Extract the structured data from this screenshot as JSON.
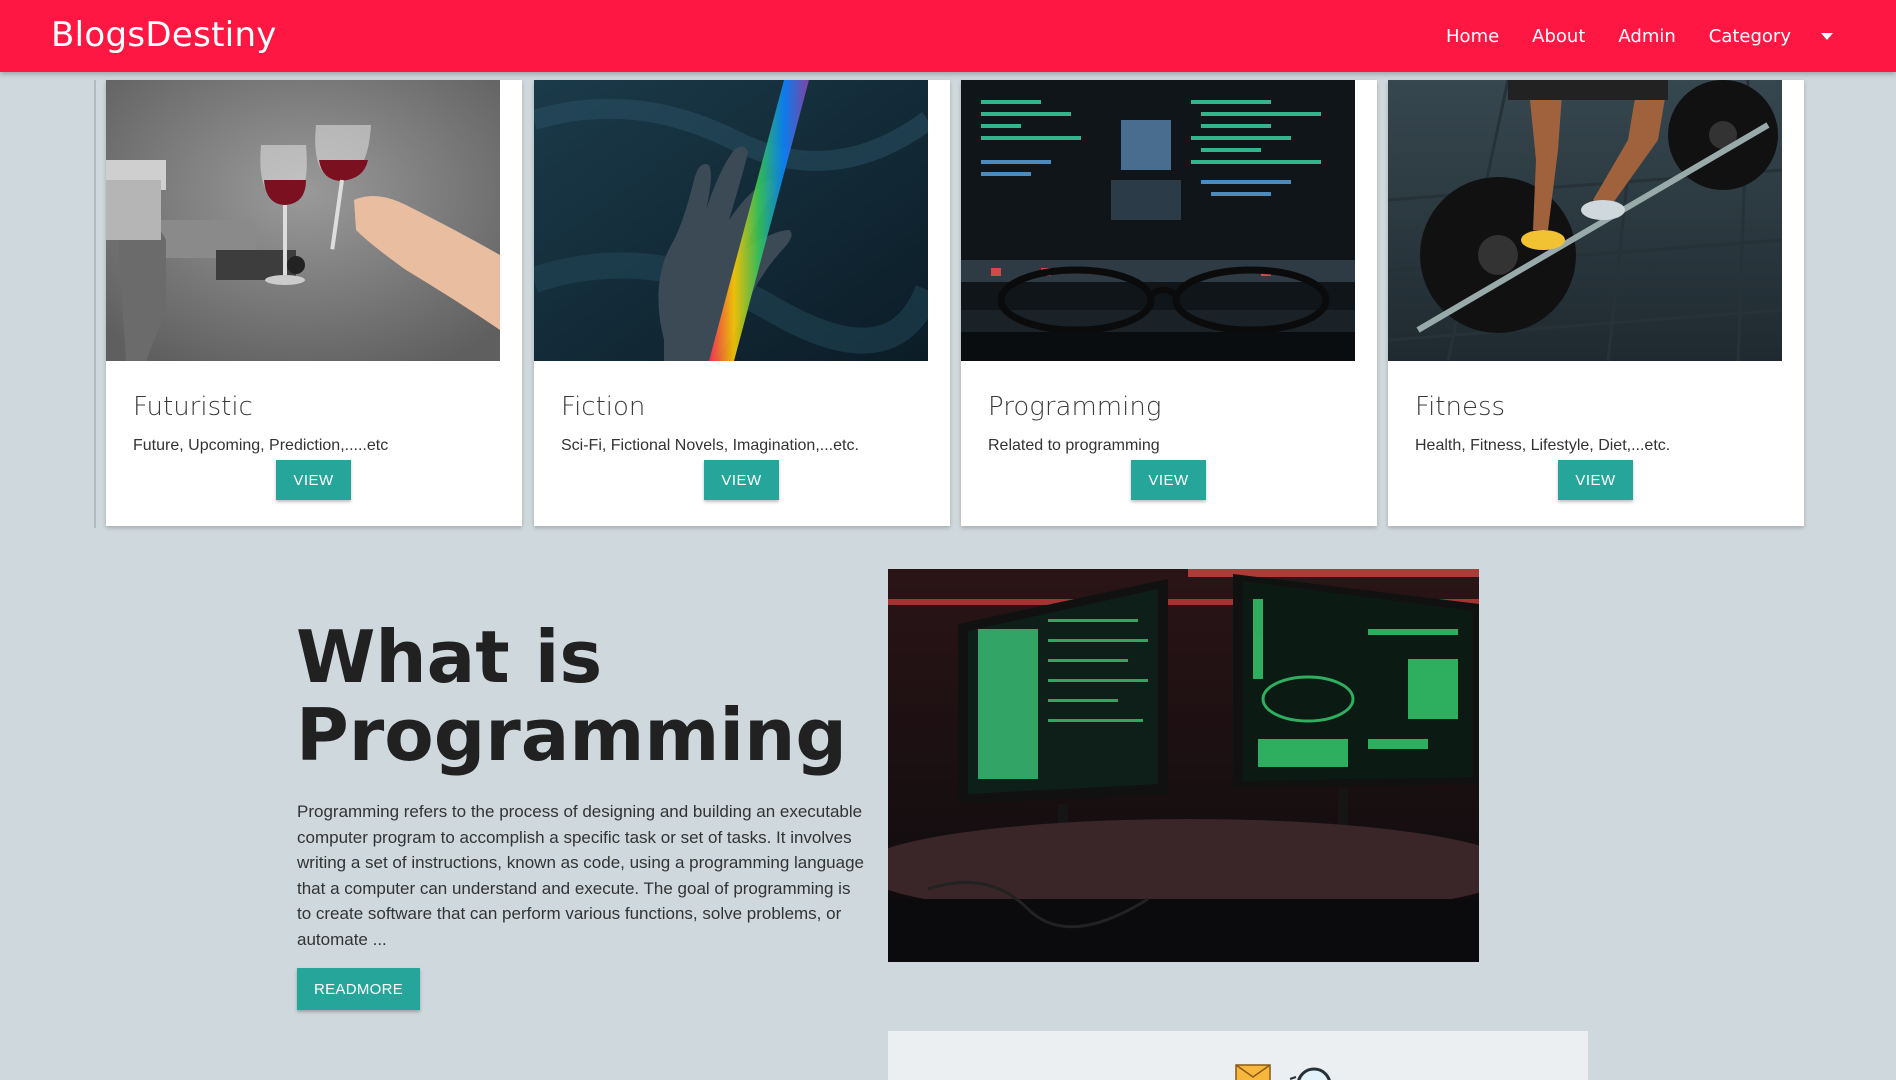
{
  "navbar": {
    "brand": "BlogsDestiny",
    "links": [
      "Home",
      "About",
      "Admin"
    ],
    "category_label": "Category",
    "bg_color": "#ff1744"
  },
  "categories": [
    {
      "title": "Futuristic",
      "description": "Future, Upcoming, Prediction,.....etc",
      "button": "VIEW",
      "image": "robot-arm-toasting-wine-glass"
    },
    {
      "title": "Fiction",
      "description": "Sci-Fi, Fictional Novels, Imagination,...etc.",
      "button": "VIEW",
      "image": "hand-with-rainbow-light"
    },
    {
      "title": "Programming",
      "description": "Related to programming",
      "button": "VIEW",
      "image": "monitor-code-with-glasses"
    },
    {
      "title": "Fitness",
      "description": "Health, Fitness, Lifestyle, Diet,...etc.",
      "button": "VIEW",
      "image": "person-lifting-barbell"
    }
  ],
  "article": {
    "title_line1": "What is",
    "title_line2": "Programming",
    "body": "Programming refers to the process of designing and building an executable computer program to accomplish a specific task or set of tasks. It involves writing a set of instructions, known as code, using a programming language that a computer can understand and execute. The goal of programming is to create software that can perform various functions, solve problems, or automate ...",
    "button": "READMORE",
    "image": "two-monitors-green-terminal"
  },
  "colors": {
    "accent": "#26a69a",
    "background": "#cfd8dc"
  }
}
